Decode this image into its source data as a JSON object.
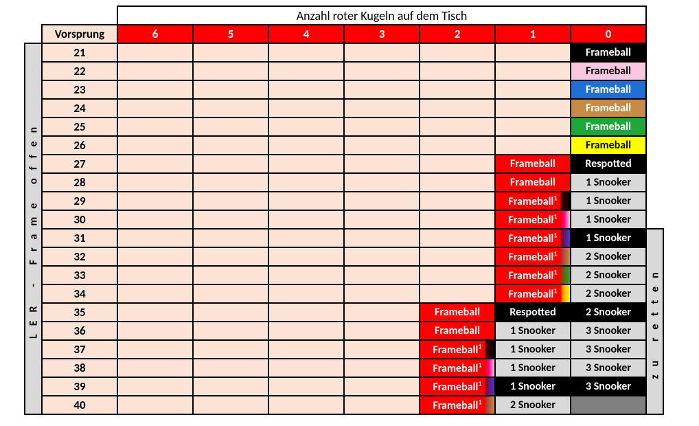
{
  "title": "Anzahl roter Kugeln auf dem Tisch",
  "vorsprung_header": "Vorsprung",
  "column_headers": [
    "6",
    "5",
    "4",
    "3",
    "2",
    "1",
    "0"
  ],
  "left_vertical": "LER - Frame offen",
  "right_vertical": "zu retten",
  "rows": [
    {
      "lead": "21",
      "cells": [
        null,
        null,
        null,
        null,
        null,
        null,
        {
          "text": "Frameball",
          "style": "c-black-white"
        }
      ]
    },
    {
      "lead": "22",
      "cells": [
        null,
        null,
        null,
        null,
        null,
        null,
        {
          "text": "Frameball",
          "style": "c-pink-black"
        }
      ]
    },
    {
      "lead": "23",
      "cells": [
        null,
        null,
        null,
        null,
        null,
        null,
        {
          "text": "Frameball",
          "style": "c-blue-white"
        }
      ]
    },
    {
      "lead": "24",
      "cells": [
        null,
        null,
        null,
        null,
        null,
        null,
        {
          "text": "Frameball",
          "style": "c-brown-white"
        }
      ]
    },
    {
      "lead": "25",
      "cells": [
        null,
        null,
        null,
        null,
        null,
        null,
        {
          "text": "Frameball",
          "style": "c-green-white"
        }
      ]
    },
    {
      "lead": "26",
      "cells": [
        null,
        null,
        null,
        null,
        null,
        null,
        {
          "text": "Frameball",
          "style": "c-yellow-black"
        }
      ]
    },
    {
      "lead": "27",
      "cells": [
        null,
        null,
        null,
        null,
        null,
        {
          "text": "Frameball",
          "style": "c-red-white"
        },
        {
          "text": "Respotted",
          "style": "c-black-white"
        }
      ]
    },
    {
      "lead": "28",
      "cells": [
        null,
        null,
        null,
        null,
        null,
        {
          "text": "Frameball",
          "style": "c-red-white"
        },
        {
          "text": "1 Snooker",
          "style": "c-grey-black"
        }
      ]
    },
    {
      "lead": "29",
      "cells": [
        null,
        null,
        null,
        null,
        null,
        {
          "text": "Frameball",
          "sup": "1",
          "style": "grad to-black"
        },
        {
          "text": "1 Snooker",
          "style": "c-grey-black"
        }
      ]
    },
    {
      "lead": "30",
      "cells": [
        null,
        null,
        null,
        null,
        null,
        {
          "text": "Frameball",
          "sup": "1",
          "style": "grad to-pink"
        },
        {
          "text": "1 Snooker",
          "style": "c-grey-black"
        }
      ]
    },
    {
      "lead": "31",
      "cells": [
        null,
        null,
        null,
        null,
        null,
        {
          "text": "Frameball",
          "sup": "1",
          "style": "grad to-blue"
        },
        {
          "text": "1 Snooker",
          "style": "c-black-white"
        }
      ]
    },
    {
      "lead": "32",
      "cells": [
        null,
        null,
        null,
        null,
        null,
        {
          "text": "Frameball",
          "sup": "1",
          "style": "grad to-brown"
        },
        {
          "text": "2 Snooker",
          "style": "c-grey-black"
        }
      ]
    },
    {
      "lead": "33",
      "cells": [
        null,
        null,
        null,
        null,
        null,
        {
          "text": "Frameball",
          "sup": "1",
          "style": "grad to-green"
        },
        {
          "text": "2 Snooker",
          "style": "c-grey-black"
        }
      ]
    },
    {
      "lead": "34",
      "cells": [
        null,
        null,
        null,
        null,
        null,
        {
          "text": "Frameball",
          "sup": "1",
          "style": "grad to-yellow"
        },
        {
          "text": "2 Snooker",
          "style": "c-grey-black"
        }
      ]
    },
    {
      "lead": "35",
      "cells": [
        null,
        null,
        null,
        null,
        {
          "text": "Frameball",
          "style": "c-red-white"
        },
        {
          "text": "Respotted",
          "style": "c-black-white"
        },
        {
          "text": "2 Snooker",
          "style": "c-black-white"
        }
      ]
    },
    {
      "lead": "36",
      "cells": [
        null,
        null,
        null,
        null,
        {
          "text": "Frameball",
          "style": "c-red-white"
        },
        {
          "text": "1 Snooker",
          "style": "c-grey-black"
        },
        {
          "text": "3 Snooker",
          "style": "c-grey-black"
        }
      ]
    },
    {
      "lead": "37",
      "cells": [
        null,
        null,
        null,
        null,
        {
          "text": "Frameball",
          "sup": "1",
          "style": "grad to-black"
        },
        {
          "text": "1 Snooker",
          "style": "c-grey-black"
        },
        {
          "text": "3 Snooker",
          "style": "c-grey-black"
        }
      ]
    },
    {
      "lead": "38",
      "cells": [
        null,
        null,
        null,
        null,
        {
          "text": "Frameball",
          "sup": "1",
          "style": "grad to-pink"
        },
        {
          "text": "1 Snooker",
          "style": "c-grey-black"
        },
        {
          "text": "3 Snooker",
          "style": "c-grey-black"
        }
      ]
    },
    {
      "lead": "39",
      "cells": [
        null,
        null,
        null,
        null,
        {
          "text": "Frameball",
          "sup": "1",
          "style": "grad to-blue"
        },
        {
          "text": "1 Snooker",
          "style": "c-black-white"
        },
        {
          "text": "3 Snooker",
          "style": "c-black-white"
        }
      ]
    },
    {
      "lead": "40",
      "cells": [
        null,
        null,
        null,
        null,
        {
          "text": "Frameball",
          "sup": "1",
          "style": "grad to-brown"
        },
        {
          "text": "2 Snooker",
          "style": "c-grey-black"
        },
        {
          "text": "",
          "style": "c-grey-solid"
        }
      ]
    }
  ]
}
